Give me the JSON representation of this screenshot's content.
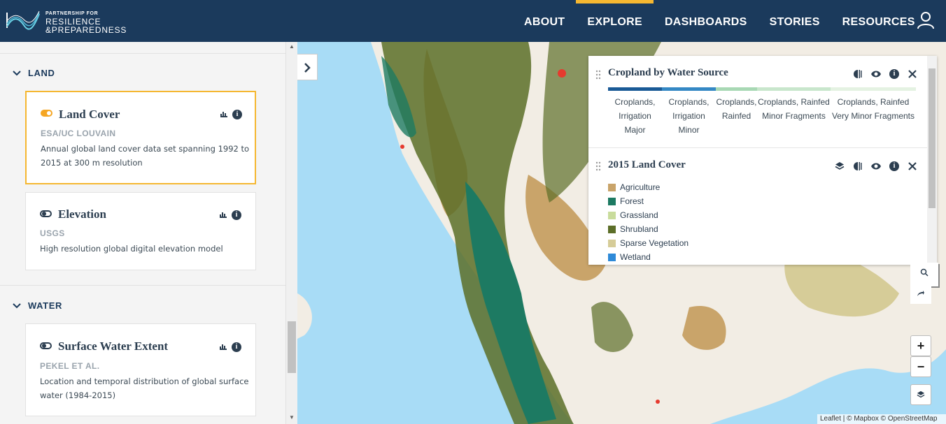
{
  "header": {
    "logo": {
      "line1": "PARTNERSHIP FOR",
      "line2": "RESILIENCE",
      "line3": "&PREPAREDNESS"
    },
    "nav": [
      "ABOUT",
      "EXPLORE",
      "DASHBOARDS",
      "STORIES",
      "RESOURCES"
    ],
    "active_nav": "EXPLORE",
    "user_icon": "user-icon"
  },
  "sidebar": {
    "groups": [
      {
        "label": "LAND",
        "cards": [
          {
            "title": "Land Cover",
            "source": "ESA/UC LOUVAIN",
            "description": "Annual global land cover data set spanning 1992 to 2015 at 300 m resolution",
            "active": true
          },
          {
            "title": "Elevation",
            "source": "USGS",
            "description": "High resolution global digital elevation model",
            "active": false
          }
        ]
      },
      {
        "label": "WATER",
        "cards": [
          {
            "title": "Surface Water Extent",
            "source": "PEKEL ET AL.",
            "description": "Location and temporal distribution of global surface water (1984-2015)",
            "active": false
          }
        ]
      }
    ]
  },
  "legend": {
    "layers": [
      {
        "title": "Cropland by Water Source",
        "ramp": [
          {
            "label": "Croplands, Irrigation Major",
            "color": "#1a5a96"
          },
          {
            "label": "Croplands, Irrigation Minor",
            "color": "#3488c4"
          },
          {
            "label": "Croplands, Rainfed",
            "color": "#a8d8b4"
          },
          {
            "label": "Croplands, Rainfed Minor Fragments",
            "color": "#c8e6cc"
          },
          {
            "label": "Croplands, Rainfed Very Minor Fragments",
            "color": "#e4f2e2"
          }
        ]
      },
      {
        "title": "2015 Land Cover",
        "items": [
          {
            "label": "Agriculture",
            "color": "#c9a46a"
          },
          {
            "label": "Forest",
            "color": "#1d7a62"
          },
          {
            "label": "Grassland",
            "color": "#c9dc9c"
          },
          {
            "label": "Shrubland",
            "color": "#5c6e28"
          },
          {
            "label": "Sparse Vegetation",
            "color": "#d6cc98"
          },
          {
            "label": "Wetland",
            "color": "#2e8ad8"
          }
        ]
      }
    ]
  },
  "map": {
    "zoom_in": "+",
    "zoom_out": "−",
    "attribution": "Leaflet | © Mapbox © OpenStreetMap"
  },
  "colors": {
    "header": "#1b3a5c",
    "accent": "#f5b731",
    "water": "#a8dcf6",
    "land": "#f2ede4"
  }
}
